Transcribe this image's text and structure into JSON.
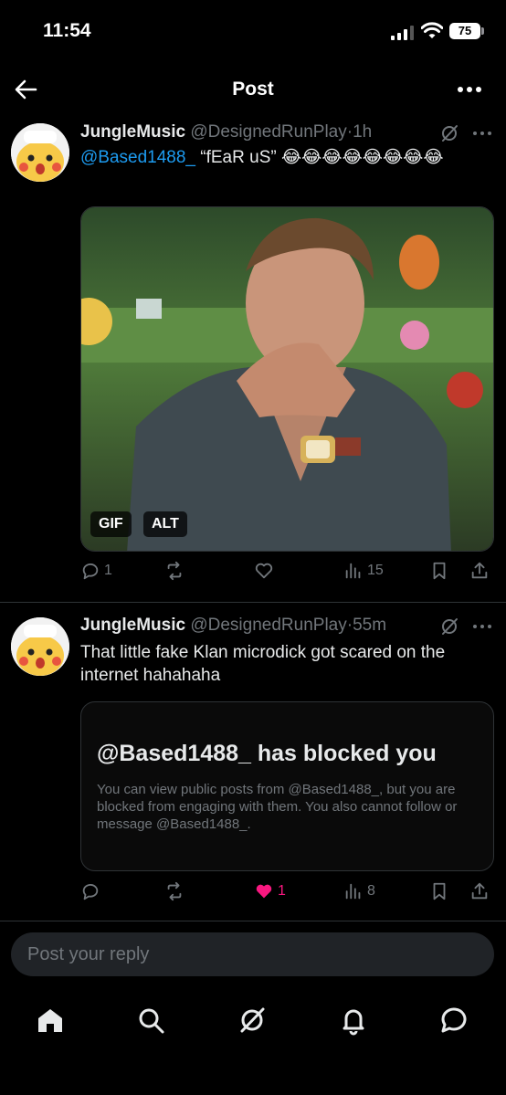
{
  "status": {
    "time": "11:54",
    "battery": "75"
  },
  "nav": {
    "title": "Post"
  },
  "posts": [
    {
      "author": "JungleMusic",
      "handle": "@DesignedRunPlay",
      "time": "1h",
      "mention": "@Based1488_",
      "text": " “fEaR uS” 😂😂😂😂😂😂😂😂",
      "media_tags": [
        "GIF",
        "ALT"
      ],
      "replies": "1",
      "views": "15"
    },
    {
      "author": "JungleMusic",
      "handle": "@DesignedRunPlay",
      "time": "55m",
      "text": "That little fake Klan microdick got scared on the internet hahahaha",
      "quote_title": "@Based1488_ has blocked you",
      "quote_body": "You can view public posts from @Based1488_, but you are blocked from engaging with them. You also cannot follow or message @Based1488_.",
      "likes": "1",
      "views": "8"
    }
  ],
  "reply": {
    "placeholder": "Post your reply"
  },
  "colors": {
    "accent": "#1d9bf0",
    "like": "#f91880",
    "muted": "#71767b"
  }
}
